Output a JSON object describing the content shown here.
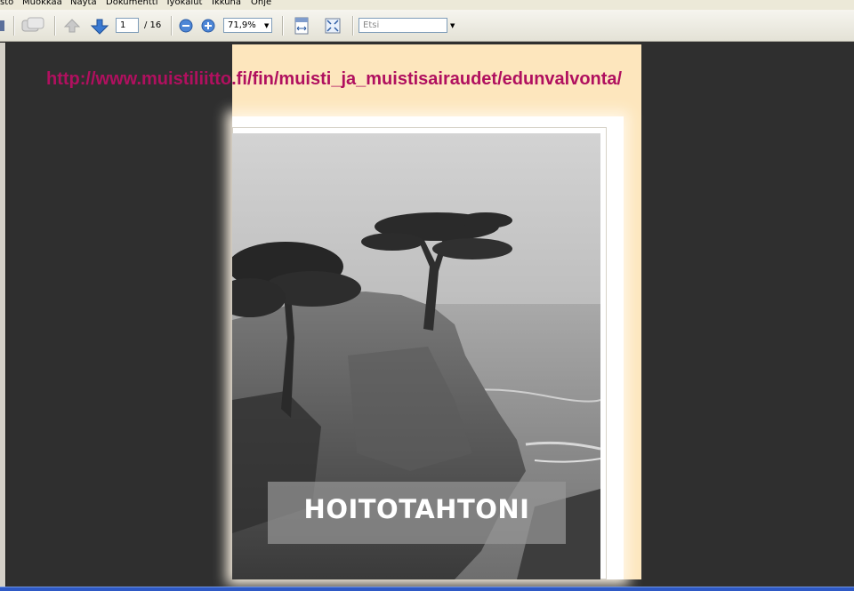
{
  "menubar": {
    "items": [
      "sto",
      "Muokkaa",
      "Näytä",
      "Dokumentti",
      "Työkalut",
      "Ikkuna",
      "Ohje"
    ]
  },
  "toolbar": {
    "page_current": "1",
    "page_total": "/ 16",
    "zoom_value": "71,9%",
    "search_placeholder": "Etsi"
  },
  "document": {
    "url_overlay": "http://www.muistiliitto.fi/fin/muisti_ja_muistisairaudet/edunvalvonta/",
    "cover_title": "HOITOTAHTONI",
    "page_color": "#fde6bd"
  },
  "colors": {
    "url_text": "#b0105f",
    "viewer_bg": "#2f2f2f"
  }
}
